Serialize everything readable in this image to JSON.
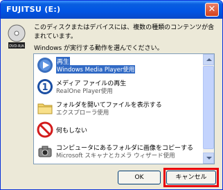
{
  "window": {
    "title": "FUJITSU (E:)",
    "close_symbol": "✕"
  },
  "drive_icon_label": "DVD-R/A",
  "message": "このディスクまたはデバイスには、複数の種類のコンテンツが含まれています。",
  "prompt": "Windows が実行する動作を選んでください。",
  "actions": [
    {
      "title": "再生",
      "subtitle": "Windows Media Player使用",
      "icon": "media-player-icon",
      "selected": true
    },
    {
      "title": "メディア ファイルの再生",
      "subtitle": "RealOne Player使用",
      "icon": "realone-icon",
      "selected": false
    },
    {
      "title": "フォルダを開いてファイルを表示する",
      "subtitle": "エクスプローラ使用",
      "icon": "folder-icon",
      "selected": false
    },
    {
      "title": "何もしない",
      "subtitle": "",
      "icon": "no-action-icon",
      "selected": false
    },
    {
      "title": "コンピュータにあるフォルダに画像をコピーする",
      "subtitle": "Microsoft スキャナとカメラ ウィザード使用",
      "icon": "camera-icon",
      "selected": false
    }
  ],
  "buttons": {
    "ok": "OK",
    "cancel": "キャンセル"
  },
  "colors": {
    "highlight": "#e8000b",
    "selection": "#316ac5"
  }
}
